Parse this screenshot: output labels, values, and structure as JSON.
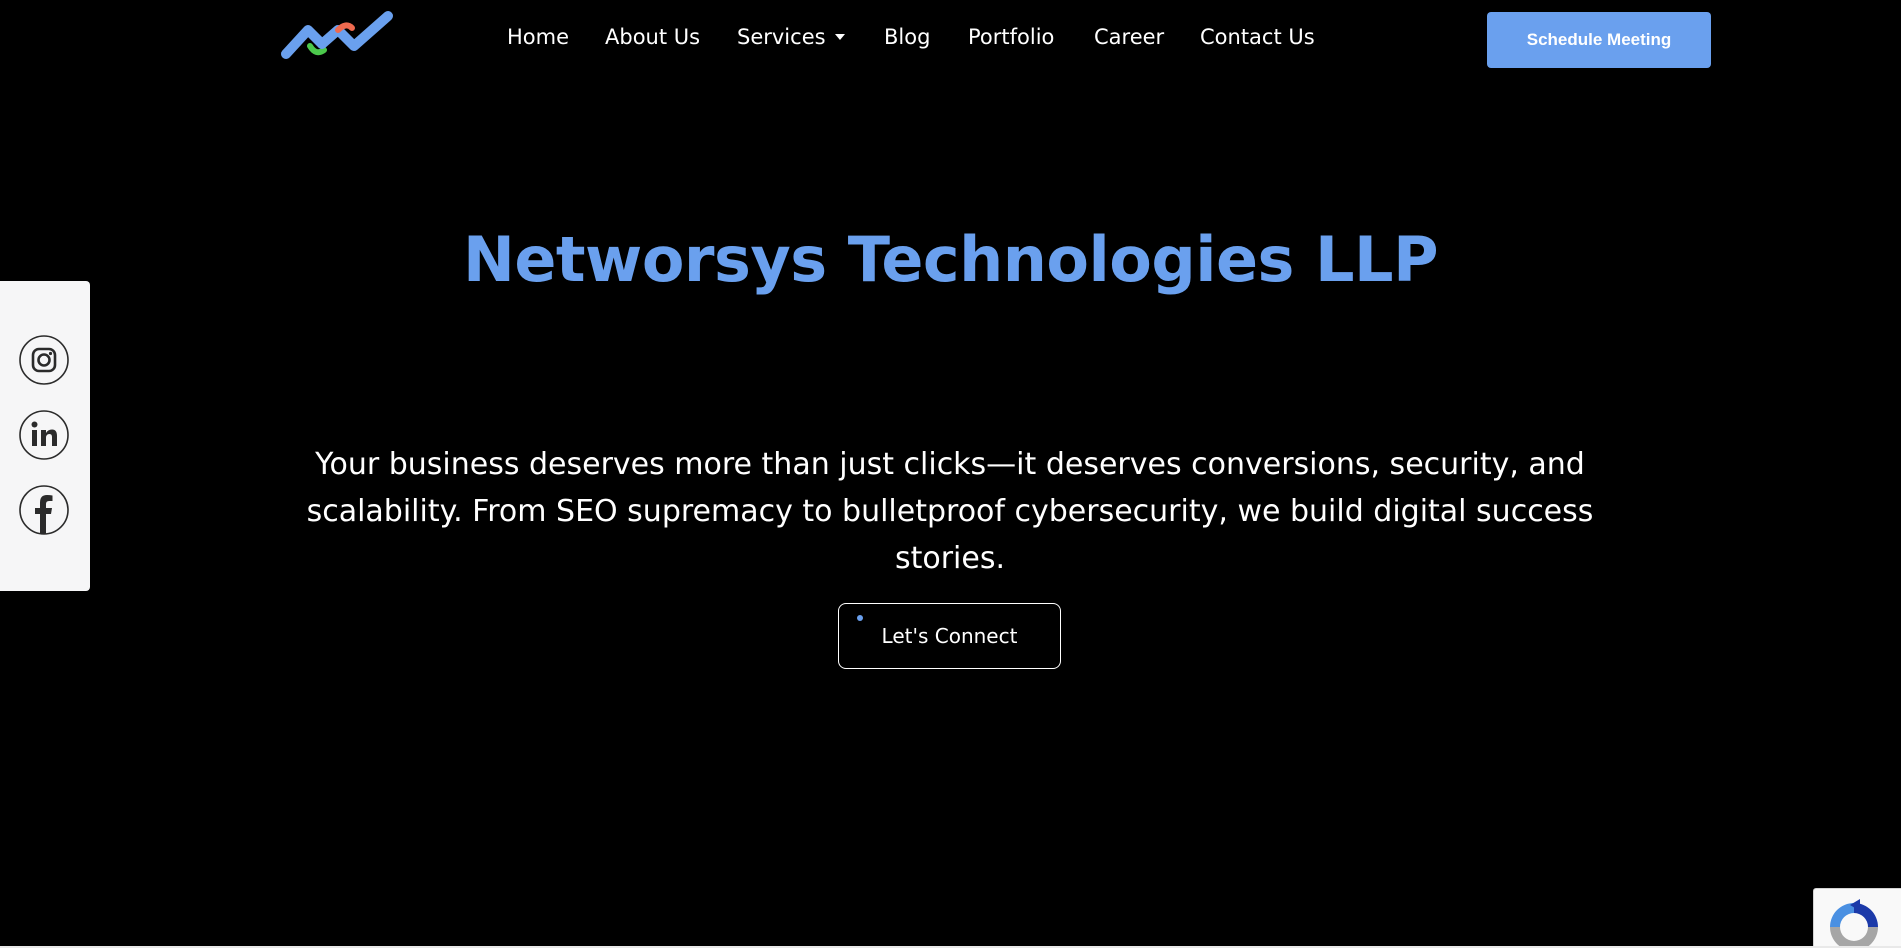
{
  "header": {
    "logo_icon": "zigzag-wave-logo-icon",
    "nav": [
      {
        "label": "Home"
      },
      {
        "label": "About Us"
      },
      {
        "label": "Services",
        "has_dropdown": true
      },
      {
        "label": "Blog"
      },
      {
        "label": "Portfolio"
      },
      {
        "label": "Career"
      },
      {
        "label": "Contact Us"
      }
    ],
    "cta_label": "Schedule Meeting"
  },
  "social": {
    "items": [
      {
        "icon": "instagram-icon"
      },
      {
        "icon": "linkedin-icon"
      },
      {
        "icon": "facebook-icon"
      }
    ]
  },
  "hero": {
    "title": "Networsys Technologies LLP",
    "description": "Your business deserves more than just clicks—it deserves conversions, security, and scalability. From SEO supremacy to bulletproof cybersecurity, we build digital success stories.",
    "connect_label": "Let's Connect"
  },
  "colors": {
    "background": "#000000",
    "accent": "#6aa0ee",
    "text": "#ffffff",
    "social_panel": "#f6f6f7"
  }
}
